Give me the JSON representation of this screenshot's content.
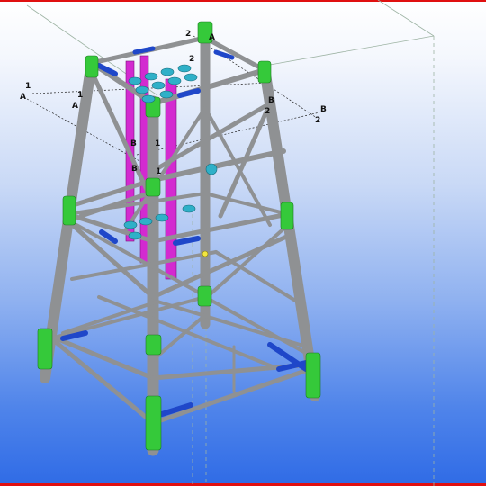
{
  "app": {
    "name": ""
  },
  "colors": {
    "leg": "#8f9193",
    "leg_joint": "#35c93a",
    "brace": "#8f9193",
    "brace_end": "#1f47c9",
    "conductor": "#d32ad0",
    "conductor_guide": "#2fb0c8",
    "frame": "#e01010",
    "gridline": "#111111"
  },
  "icons": {
    "point_marker": "yellow-dot"
  },
  "model": {
    "gridlines": [
      {
        "name": "1",
        "label": "1",
        "label2": "1"
      },
      {
        "name": "2",
        "label": "2",
        "label2": "2"
      },
      {
        "name": "A",
        "label": "A",
        "label2": "A"
      },
      {
        "name": "B",
        "label": "B",
        "label2": "B"
      }
    ],
    "grid_marks": {
      "mark_1_left": "1",
      "mark_A_left": "A",
      "mark_A_mid": "A",
      "mark_1_mid": "1",
      "mark_2_top": "2",
      "mark_A_top": "A",
      "mark_2_right": "2",
      "mark_B_right": "B",
      "mark_B_right2": "B",
      "mark_2_right2": "2",
      "mark_B_inner": "B",
      "mark_1_inner": "1",
      "mark_B_inner2": "B",
      "mark_1_inner2": "1",
      "mark_2_mid": "2"
    }
  }
}
